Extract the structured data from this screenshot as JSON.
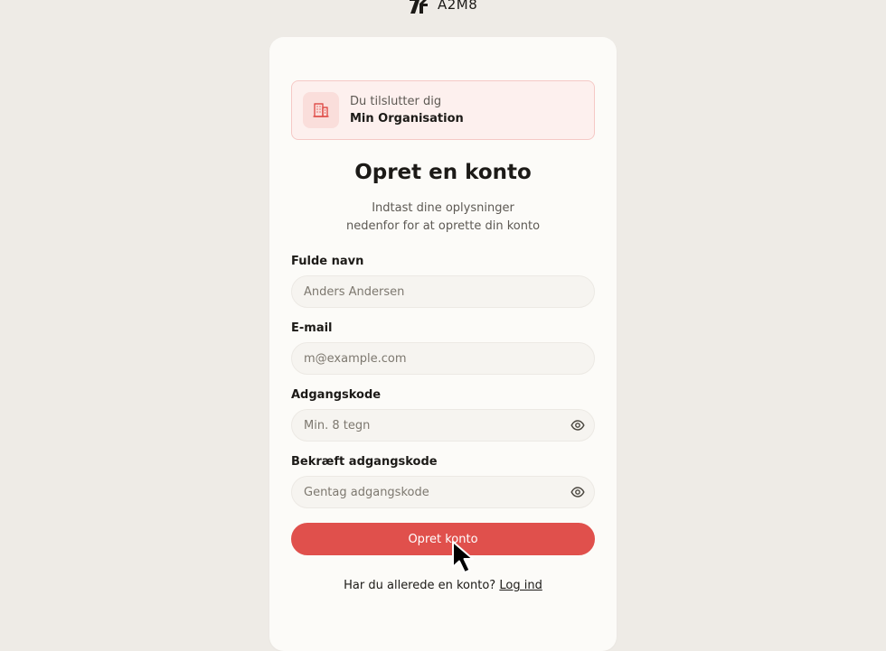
{
  "brand": {
    "name": "A2M8",
    "logo_icon": "brand-logo-icon"
  },
  "org_banner": {
    "icon": "building-icon",
    "subtitle": "Du tilslutter dig",
    "org_name": "Min Organisation"
  },
  "form": {
    "title": "Opret en konto",
    "subtitle_line1": "Indtast dine oplysninger",
    "subtitle_line2": "nedenfor for at oprette din konto",
    "fields": [
      {
        "label": "Fulde navn",
        "placeholder": "Anders Andersen"
      },
      {
        "label": "E-mail",
        "placeholder": "m@example.com"
      },
      {
        "label": "Adgangskode",
        "placeholder": "Min. 8 tegn",
        "toggle_icon": "eye-icon"
      },
      {
        "label": "Bekræft adgangskode",
        "placeholder": "Gentag adgangskode",
        "toggle_icon": "eye-icon"
      }
    ],
    "submit_label": "Opret konto",
    "footer_text": "Har du allerede en konto?",
    "login_link": "Log ind"
  },
  "colors": {
    "background": "#eeebe6",
    "card": "#fcfbf8",
    "accent": "#e0504c",
    "banner_bg": "#fdf0ee",
    "banner_border": "#f5c9c6"
  }
}
